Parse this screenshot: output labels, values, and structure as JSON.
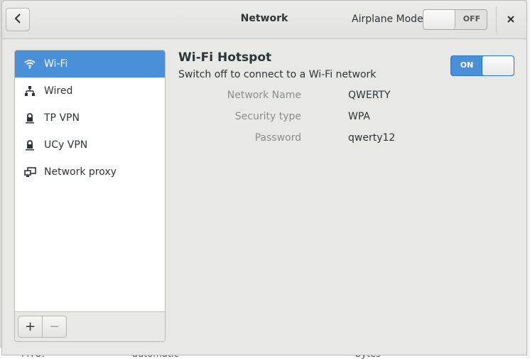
{
  "background": {
    "row_left": "MTU:",
    "row_mid": "automatic",
    "row_right": "bytes"
  },
  "header": {
    "title": "Network",
    "back_icon": "chevron-left-icon",
    "airplane_mode_label": "Airplane Mode",
    "airplane_mode_state": "OFF",
    "close_icon": "close-icon"
  },
  "sidebar": {
    "items": [
      {
        "label": "Wi-Fi",
        "icon": "wifi-icon",
        "selected": true
      },
      {
        "label": "Wired",
        "icon": "wired-network-icon",
        "selected": false
      },
      {
        "label": "TP VPN",
        "icon": "vpn-lock-icon",
        "selected": false
      },
      {
        "label": "UCy VPN",
        "icon": "vpn-lock-icon",
        "selected": false
      },
      {
        "label": "Network proxy",
        "icon": "network-proxy-icon",
        "selected": false
      }
    ],
    "add_label": "+",
    "remove_label": "−"
  },
  "hotspot": {
    "title": "Wi-Fi Hotspot",
    "subtitle": "Switch off to connect to a Wi-Fi network",
    "switch_state": "ON",
    "properties": [
      {
        "label": "Network Name",
        "value": "QWERTY"
      },
      {
        "label": "Security type",
        "value": "WPA"
      },
      {
        "label": "Password",
        "value": "qwerty12"
      }
    ]
  },
  "colors": {
    "accent": "#4a90d9",
    "window_bg": "#e8e8e7",
    "dim_text": "#8b8e8f"
  }
}
